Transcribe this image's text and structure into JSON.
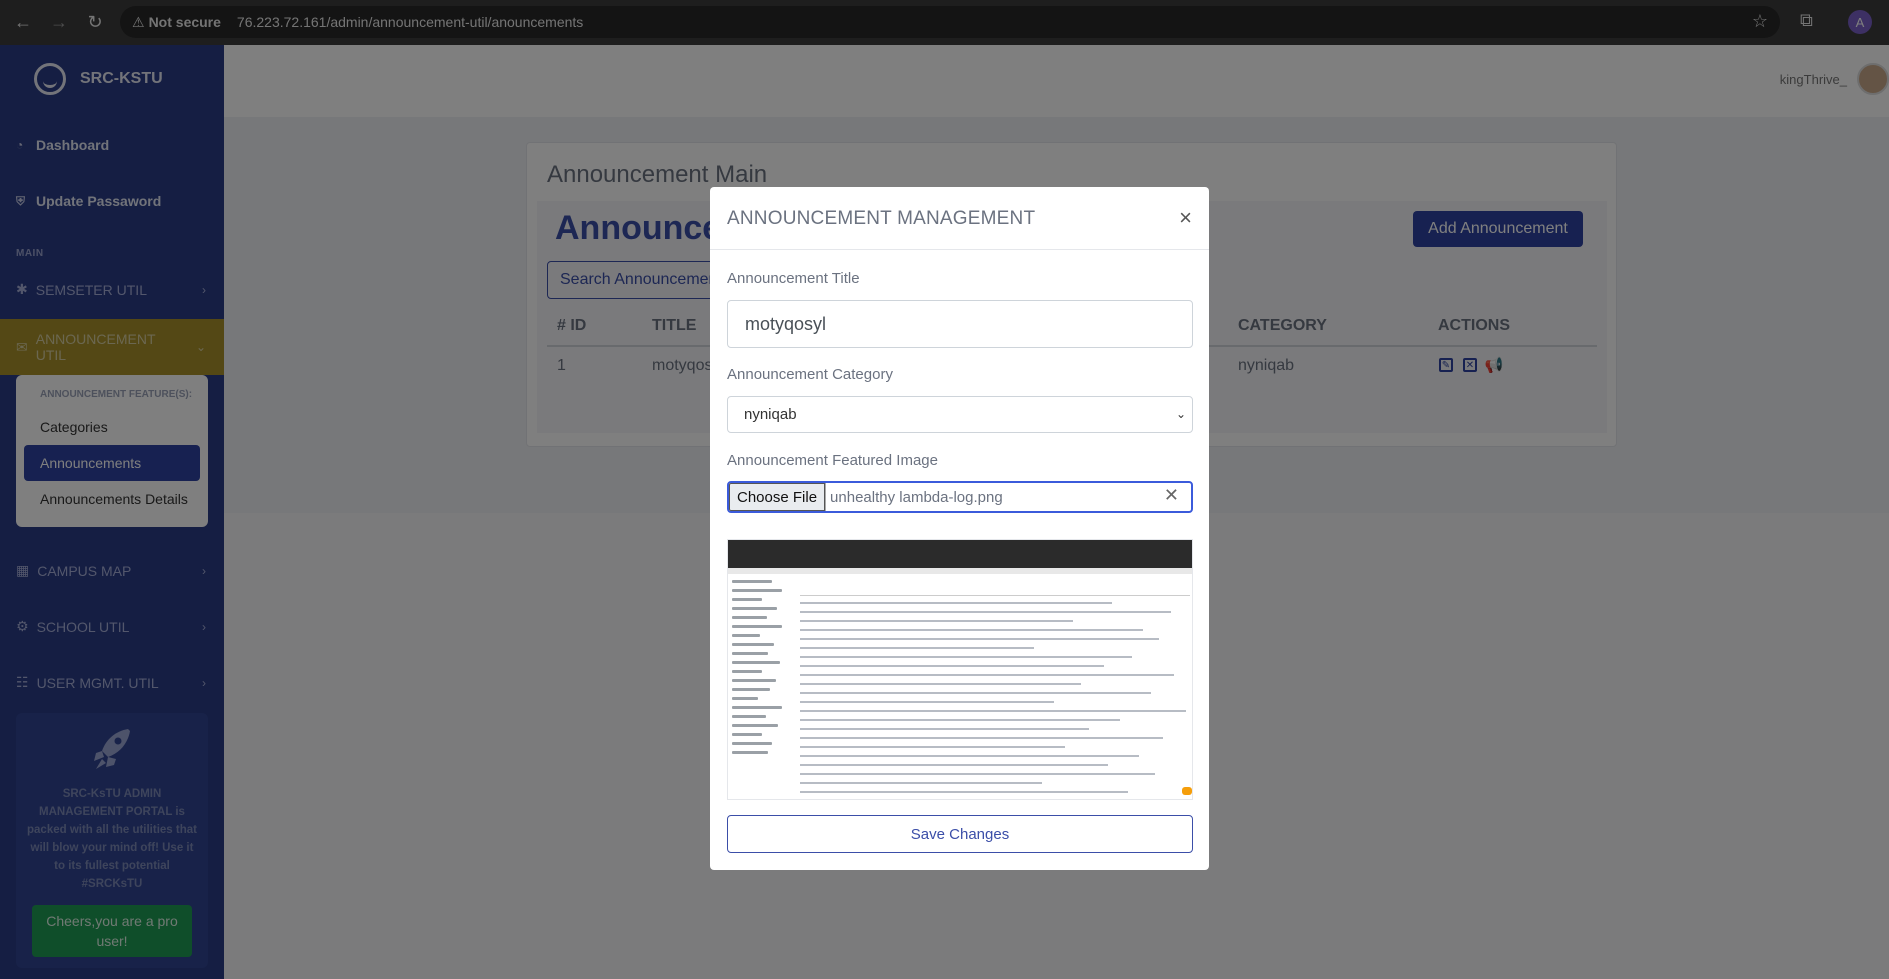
{
  "browser": {
    "security_label": "Not secure",
    "url": "76.223.72.161/admin/announcement-util/anouncements",
    "profile_initial": "A"
  },
  "sidebar": {
    "brand": "SRC-KSTU",
    "items": [
      {
        "label": "Dashboard"
      },
      {
        "label": "Update Passaword"
      }
    ],
    "section_label": "MAIN",
    "collapsibles": [
      {
        "label": "SEMSETER UTIL"
      },
      {
        "label": "ANNOUNCEMENT UTIL"
      },
      {
        "label": "CAMPUS MAP"
      },
      {
        "label": "SCHOOL UTIL"
      },
      {
        "label": "USER MGMT. UTIL"
      }
    ],
    "submenu": {
      "heading": "ANNOUNCEMENT FEATURE(S):",
      "items": [
        {
          "label": "Categories"
        },
        {
          "label": "Announcements"
        },
        {
          "label": "Announcements Details"
        }
      ]
    },
    "promo": {
      "text": "SRC-KsTU ADMIN MANAGEMENT PORTAL is packed with all the utilities that will blow your mind off! Use it to its fullest potential #SRCKsTU",
      "button": "Cheers,you are a pro user!"
    }
  },
  "topbar": {
    "username": "kingThrive_"
  },
  "main": {
    "card_title": "Announcement Main",
    "heading": "Announcements",
    "add_button": "Add Announcement",
    "search_placeholder": "Search Announcements",
    "columns": [
      "# ID",
      "TITLE",
      "CATEGORY",
      "ACTIONS"
    ],
    "rows": [
      {
        "id": "1",
        "title": "motyqosyl",
        "category": "nyniqab"
      }
    ]
  },
  "modal": {
    "title": "ANNOUNCEMENT MANAGEMENT",
    "close": "×",
    "title_label": "Announcement Title",
    "title_value": "motyqosyl",
    "category_label": "Announcement Category",
    "category_value": "nyniqab",
    "image_label": "Announcement Featured Image",
    "choose_file": "Choose File",
    "file_name": "unhealthy lambda-log.png",
    "save_button": "Save Changes"
  }
}
